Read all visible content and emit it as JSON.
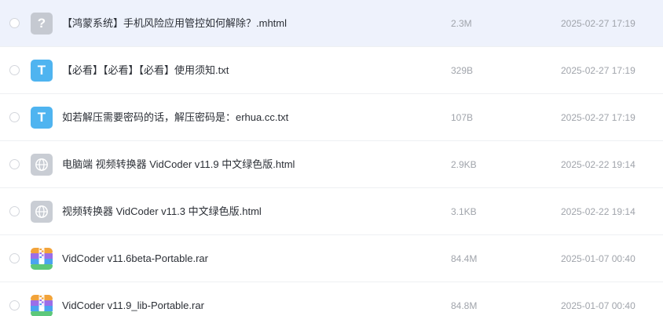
{
  "files": [
    {
      "name": "【鸿蒙系统】手机风险应用管控如何解除？.mhtml",
      "size": "2.3M",
      "date": "2025-02-27 17:19",
      "icon": "unknown-file-icon",
      "icon_glyph": "?",
      "selected": true
    },
    {
      "name": "【必看】【必看】【必看】使用须知.txt",
      "size": "329B",
      "date": "2025-02-27 17:19",
      "icon": "text-file-icon",
      "icon_glyph": "T"
    },
    {
      "name": "如若解压需要密码的话，解压密码是：erhua.cc.txt",
      "size": "107B",
      "date": "2025-02-27 17:19",
      "icon": "text-file-icon",
      "icon_glyph": "T"
    },
    {
      "name": "电脑端 视频转换器 VidCoder v11.9 中文绿色版.html",
      "size": "2.9KB",
      "date": "2025-02-22 19:14",
      "icon": "web-file-icon"
    },
    {
      "name": "视频转换器 VidCoder v11.3 中文绿色版.html",
      "size": "3.1KB",
      "date": "2025-02-22 19:14",
      "icon": "web-file-icon"
    },
    {
      "name": "VidCoder v11.6beta-Portable.rar",
      "size": "84.4M",
      "date": "2025-01-07 00:40",
      "icon": "archive-file-icon"
    },
    {
      "name": "VidCoder v11.9_lib-Portable.rar",
      "size": "84.8M",
      "date": "2025-01-07 00:40",
      "icon": "archive-file-icon"
    }
  ],
  "colors": {
    "selected_row": "#eef2fc",
    "text_file_icon": "#4fb4f0",
    "unknown_file_icon": "#c5c9d1",
    "web_file_icon": "#c9cdd4"
  }
}
